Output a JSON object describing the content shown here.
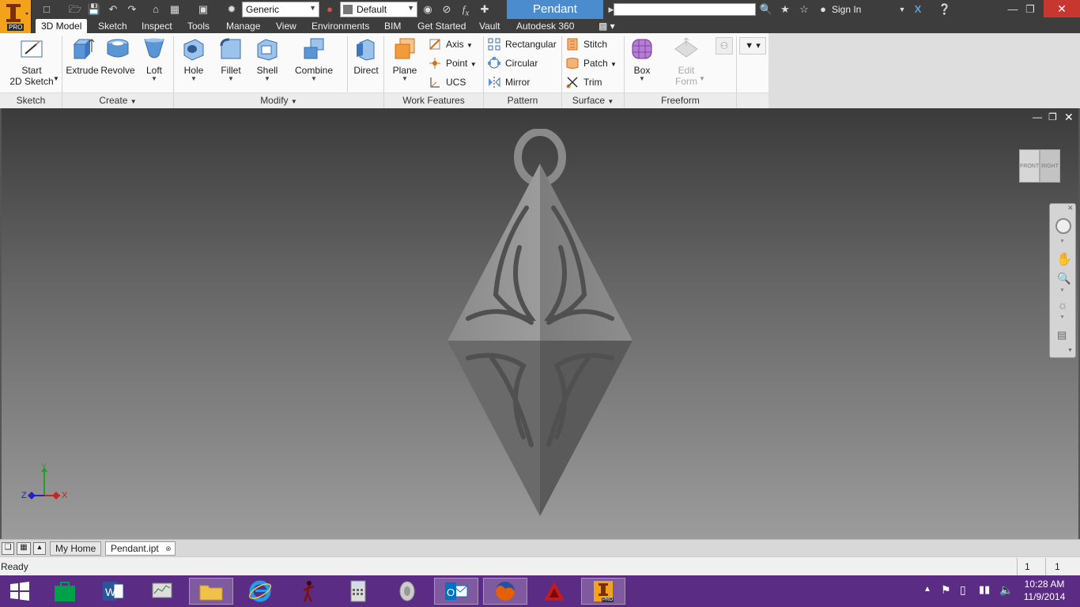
{
  "app": {
    "title": "Pendant",
    "logo_text": "PRO",
    "search_placeholder": "",
    "sign_in": "Sign In"
  },
  "qat": {
    "appearance": "Generic",
    "material": "Default"
  },
  "ribbon_tabs": [
    "3D Model",
    "Sketch",
    "Inspect",
    "Tools",
    "Manage",
    "View",
    "Environments",
    "BIM",
    "Get Started",
    "Vault",
    "Autodesk 360"
  ],
  "ribbon": {
    "sketch": {
      "start_line1": "Start",
      "start_line2": "2D Sketch",
      "panel": "Sketch"
    },
    "create": {
      "extrude": "Extrude",
      "revolve": "Revolve",
      "loft": "Loft",
      "panel": "Create"
    },
    "modify": {
      "hole": "Hole",
      "fillet": "Fillet",
      "shell": "Shell",
      "combine": "Combine",
      "direct": "Direct",
      "panel": "Modify"
    },
    "work": {
      "plane": "Plane",
      "axis": "Axis",
      "point": "Point",
      "ucs": "UCS",
      "panel": "Work Features"
    },
    "pattern": {
      "rect": "Rectangular",
      "circ": "Circular",
      "mirror": "Mirror",
      "panel": "Pattern"
    },
    "surface": {
      "stitch": "Stitch",
      "patch": "Patch",
      "trim": "Trim",
      "panel": "Surface"
    },
    "freeform": {
      "box": "Box",
      "edit_line1": "Edit",
      "edit_line2": "Form",
      "panel": "Freeform"
    }
  },
  "viewcube": {
    "front": "FRONT",
    "right": "RIGHT"
  },
  "axes": {
    "x": "X",
    "y": "Y",
    "z": "Z"
  },
  "doc_tabs": {
    "home": "My Home",
    "doc": "Pendant.ipt"
  },
  "status": {
    "text": "Ready",
    "count1": "1",
    "count2": "1"
  },
  "taskbar": {
    "time": "10:28 AM",
    "date": "11/9/2014",
    "inventor_badge": "PRO"
  },
  "colors": {
    "title_bg": "#3d3d3d",
    "title_tab": "#4a8ccd",
    "taskbar": "#5b2c83",
    "ribbon_bg": "#fafafa"
  }
}
